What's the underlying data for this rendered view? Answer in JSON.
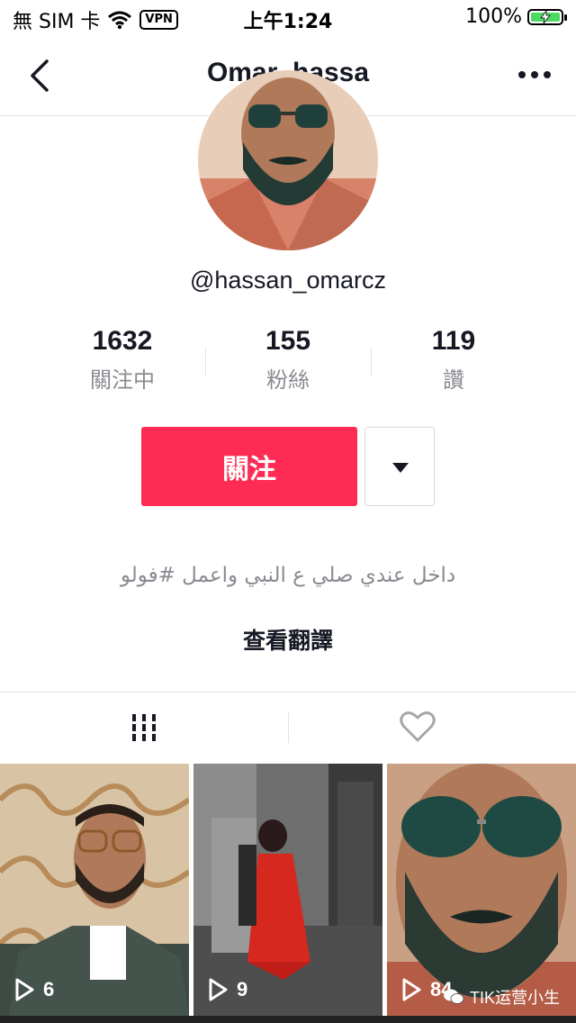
{
  "status_bar": {
    "carrier": "無 SIM 卡",
    "vpn": "VPN",
    "time": "上午1:24",
    "battery_percent": "100%",
    "battery_level": 1.0
  },
  "nav": {
    "title": "Omar_hassa",
    "back_icon": "chevron-left-icon",
    "more_icon": "more-horizontal-icon"
  },
  "profile": {
    "handle": "@hassan_omarcz",
    "stats": [
      {
        "value": "1632",
        "label": "關注中"
      },
      {
        "value": "155",
        "label": "粉絲"
      },
      {
        "value": "119",
        "label": "讚"
      }
    ],
    "follow_label": "關注",
    "bio": "داخل عندي صلي ع النبي واعمل #فولو",
    "translate_label": "查看翻譯"
  },
  "tabs": [
    {
      "name": "videos-grid-icon",
      "active": true
    },
    {
      "name": "heart-outline-icon",
      "active": false
    }
  ],
  "videos": [
    {
      "views": "6"
    },
    {
      "views": "9"
    },
    {
      "views": "84"
    }
  ],
  "watermark": "TIK运营小生",
  "colors": {
    "accent": "#fe2c55",
    "text_primary": "#161823",
    "text_secondary": "#8a8b91",
    "battery_green": "#4cd964"
  }
}
